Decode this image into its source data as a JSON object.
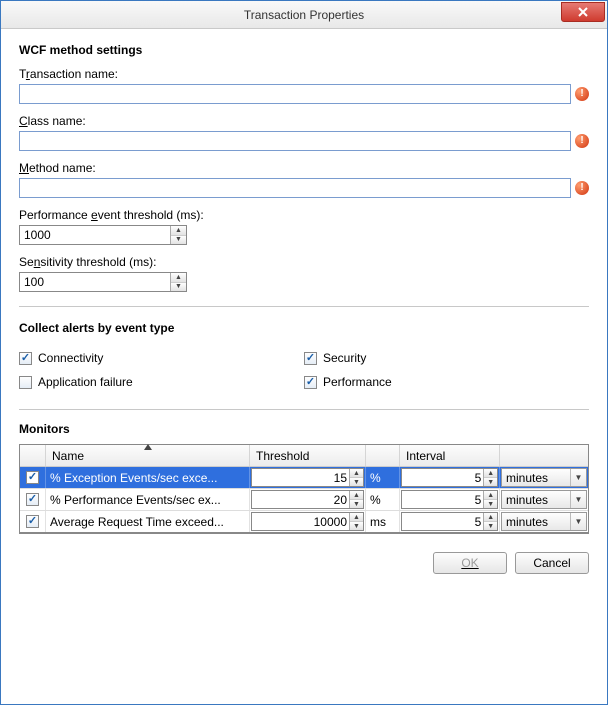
{
  "window": {
    "title": "Transaction Properties"
  },
  "section1": {
    "heading": "WCF method settings",
    "transaction_label_pre": "T",
    "transaction_label_u": "r",
    "transaction_label_post": "ansaction name:",
    "transaction_value": "",
    "class_label_u": "C",
    "class_label_post": "lass name:",
    "class_value": "",
    "method_label_u": "M",
    "method_label_post": "ethod name:",
    "method_value": "",
    "perf_label_pre": "Performance ",
    "perf_label_u": "e",
    "perf_label_post": "vent threshold (ms):",
    "perf_value": "1000",
    "sens_label_pre": "Se",
    "sens_label_u": "n",
    "sens_label_post": "sitivity threshold (ms):",
    "sens_value": "100"
  },
  "alerts": {
    "heading": "Collect alerts by event type",
    "items": [
      {
        "label": "Connectivity",
        "checked": true
      },
      {
        "label": "Application failure",
        "checked": false
      },
      {
        "label": "Security",
        "checked": true
      },
      {
        "label": "Performance",
        "checked": true
      }
    ]
  },
  "monitors": {
    "heading": "Monitors",
    "columns": {
      "name": "Name",
      "threshold": "Threshold",
      "interval": "Interval"
    },
    "rows": [
      {
        "checked": true,
        "name": "% Exception Events/sec exce...",
        "threshold": "15",
        "unit": "%",
        "interval": "5",
        "interval_unit": "minutes",
        "selected": true
      },
      {
        "checked": true,
        "name": "% Performance Events/sec ex...",
        "threshold": "20",
        "unit": "%",
        "interval": "5",
        "interval_unit": "minutes",
        "selected": false
      },
      {
        "checked": true,
        "name": "Average Request Time exceed...",
        "threshold": "10000",
        "unit": "ms",
        "interval": "5",
        "interval_unit": "minutes",
        "selected": false
      }
    ]
  },
  "buttons": {
    "ok": "OK",
    "cancel": "Cancel"
  }
}
